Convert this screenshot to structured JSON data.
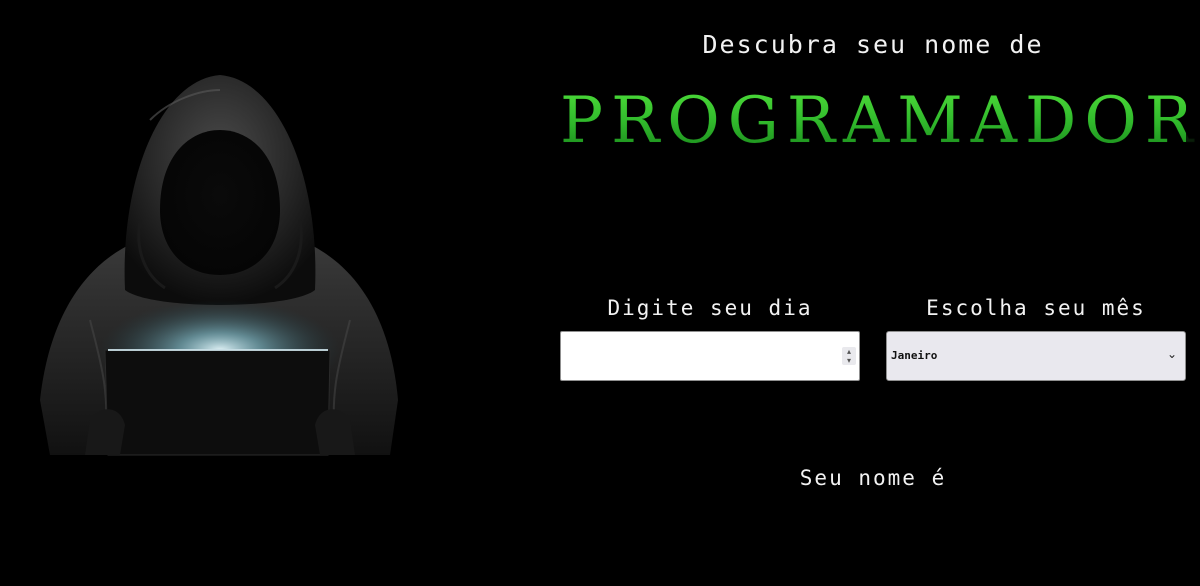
{
  "header": {
    "subtitle": "Descubra seu nome de",
    "title": "PROGRAMADOR"
  },
  "form": {
    "day_label": "Digite seu dia",
    "day_value": "",
    "month_label": "Escolha seu mês",
    "month_selected": "Janeiro"
  },
  "result": {
    "label": "Seu nome é"
  },
  "colors": {
    "background": "#000000",
    "title_green": "#2fb52f",
    "text": "#f2f2f2"
  },
  "icons": {
    "hero": "hooded-hacker-with-laptop-image",
    "select_arrow": "chevron-down-icon",
    "spinner": "number-spinner-icon"
  }
}
